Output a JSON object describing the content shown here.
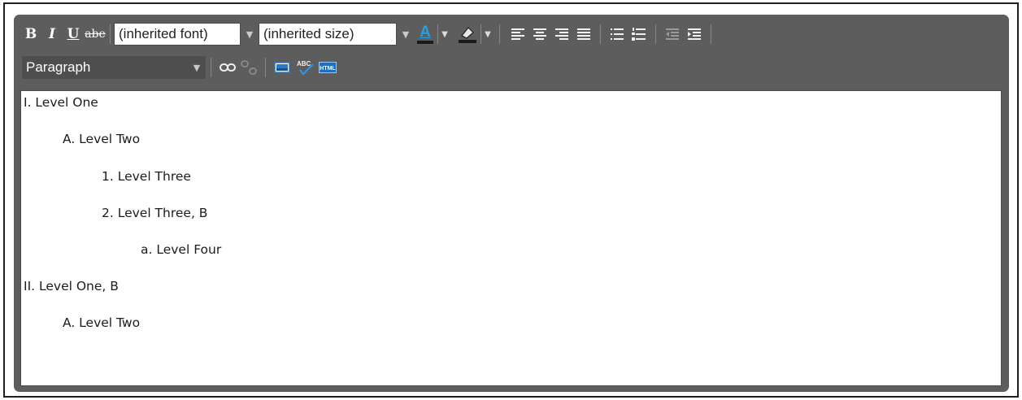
{
  "toolbar": {
    "bold_label": "B",
    "italic_label": "I",
    "underline_label": "U",
    "strike_label": "abe",
    "font_value": "(inherited font)",
    "size_value": "(inherited size)",
    "text_color_label": "A",
    "block_format_value": "Paragraph",
    "icons": [
      "bold",
      "italic",
      "underline",
      "strikethrough",
      "text-color-icon",
      "highlight-icon",
      "align-left-icon",
      "align-center-icon",
      "align-right-icon",
      "justify-icon",
      "bullet-list-icon",
      "numbered-list-icon",
      "outdent-icon",
      "indent-icon",
      "link-icon",
      "unlink-icon",
      "image-icon",
      "spellcheck-icon",
      "html-source-icon"
    ],
    "spellcheck_label": "ABC",
    "html_label": "HTML"
  },
  "colors": {
    "toolbar_bg": "#5d5d5d",
    "text_color_underline": "#1a1a1a",
    "text_color_glyph": "#2a9fe0",
    "icon_blue": "#2b78c4"
  },
  "content": {
    "lines": [
      {
        "text": "I. Level One",
        "level": 0
      },
      {
        "text": "A. Level Two",
        "level": 1
      },
      {
        "text": "1. Level Three",
        "level": 2
      },
      {
        "text": "2. Level Three, B",
        "level": 2
      },
      {
        "text": "a. Level Four",
        "level": 3
      },
      {
        "text": "II. Level One, B",
        "level": 0
      },
      {
        "text": "A. Level Two",
        "level": 1
      }
    ]
  }
}
